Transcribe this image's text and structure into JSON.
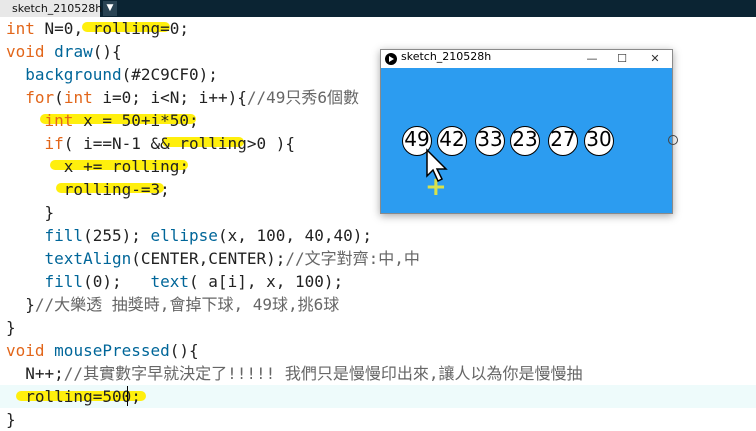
{
  "tab": {
    "name": "sketch_210528h",
    "menu_glyph": "▼"
  },
  "code_lines": [
    [
      {
        "t": "int",
        "c": "kw"
      },
      {
        "t": " N=0, rolling=0;",
        "c": ""
      }
    ],
    [
      {
        "t": "void",
        "c": "kw"
      },
      {
        "t": " ",
        "c": ""
      },
      {
        "t": "draw",
        "c": "fn"
      },
      {
        "t": "(){",
        "c": ""
      }
    ],
    [
      {
        "t": "  ",
        "c": ""
      },
      {
        "t": "background",
        "c": "fn"
      },
      {
        "t": "(#2C9CF0);",
        "c": ""
      }
    ],
    [
      {
        "t": "  ",
        "c": ""
      },
      {
        "t": "for",
        "c": "kw"
      },
      {
        "t": "(",
        "c": ""
      },
      {
        "t": "int",
        "c": "kw"
      },
      {
        "t": " i=0; i<N; i++){",
        "c": ""
      },
      {
        "t": "//49只秀6個數",
        "c": "cm"
      }
    ],
    [
      {
        "t": "    ",
        "c": ""
      },
      {
        "t": "int",
        "c": "kw"
      },
      {
        "t": " x = 50+i*50;",
        "c": ""
      }
    ],
    [
      {
        "t": "    ",
        "c": ""
      },
      {
        "t": "if",
        "c": "kw"
      },
      {
        "t": "( i==N-1 && rolling>0 ){",
        "c": ""
      }
    ],
    [
      {
        "t": "      x += rolling;",
        "c": ""
      }
    ],
    [
      {
        "t": "      rolling-=3;",
        "c": ""
      }
    ],
    [
      {
        "t": "    }",
        "c": ""
      }
    ],
    [
      {
        "t": "    ",
        "c": ""
      },
      {
        "t": "fill",
        "c": "fn"
      },
      {
        "t": "(255); ",
        "c": ""
      },
      {
        "t": "ellipse",
        "c": "fn"
      },
      {
        "t": "(x, 100, 40,40);",
        "c": ""
      }
    ],
    [
      {
        "t": "    ",
        "c": ""
      },
      {
        "t": "textAlign",
        "c": "fn"
      },
      {
        "t": "(CENTER,CENTER);",
        "c": ""
      },
      {
        "t": "//文字對齊:中,中",
        "c": "cm"
      }
    ],
    [
      {
        "t": "    ",
        "c": ""
      },
      {
        "t": "fill",
        "c": "fn"
      },
      {
        "t": "(0);   ",
        "c": ""
      },
      {
        "t": "text",
        "c": "fn"
      },
      {
        "t": "( a[i], x, 100);",
        "c": ""
      }
    ],
    [
      {
        "t": "  }",
        "c": ""
      },
      {
        "t": "//大樂透 抽獎時,會掉下球, 49球,挑6球",
        "c": "cm"
      }
    ],
    [
      {
        "t": "}",
        "c": ""
      }
    ],
    [
      {
        "t": "void",
        "c": "kw"
      },
      {
        "t": " ",
        "c": ""
      },
      {
        "t": "mousePressed",
        "c": "fn"
      },
      {
        "t": "(){",
        "c": ""
      }
    ],
    [
      {
        "t": "  N++;",
        "c": ""
      },
      {
        "t": "//其實數字早就決定了!!!!! 我們只是慢慢印出來,讓人以為你是慢慢抽",
        "c": "cm"
      }
    ],
    [
      {
        "t": "  rolling=500;",
        "c": ""
      }
    ],
    [
      {
        "t": "}",
        "c": ""
      }
    ]
  ],
  "sketch_window": {
    "title": "sketch_210528h",
    "minimize_glyph": "—",
    "maximize_glyph": "☐",
    "close_glyph": "✕",
    "background": "#2C9CF0",
    "balls": [
      "49",
      "42",
      "33",
      "23",
      "27",
      "30"
    ],
    "plus_glyph": "+"
  },
  "icons": {
    "app": "processing-icon",
    "pointer": "mouse-pointer-icon"
  }
}
